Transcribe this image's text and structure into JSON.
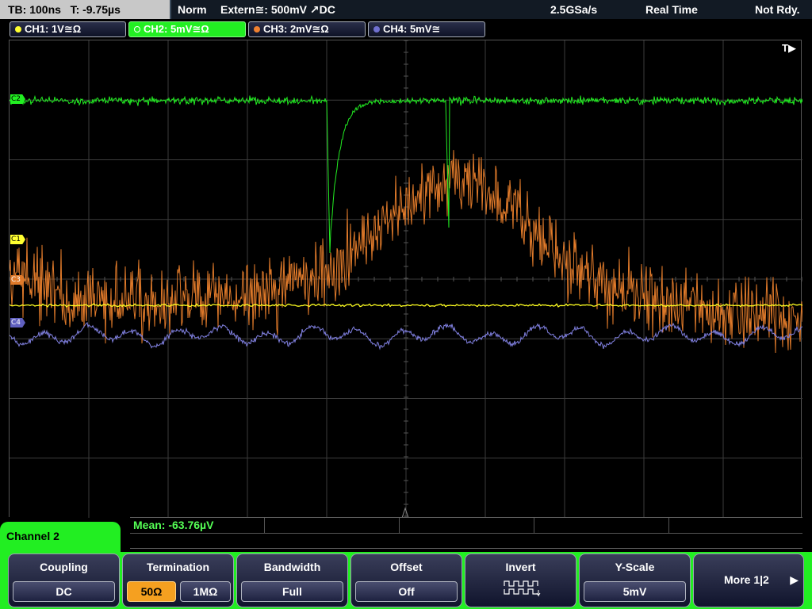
{
  "status": {
    "timebase": "TB: 100ns   T: -9.75µs",
    "trigger_mode": "Norm",
    "trigger_source": "Extern≅: 500mV ↗DC",
    "sample_rate": "2.5GSa/s",
    "acq_mode": "Real Time",
    "state": "Not Rdy."
  },
  "channels": [
    {
      "label": "CH1: 1V≅Ω",
      "color": "#ffff30"
    },
    {
      "label": "CH2: 5mV≅Ω",
      "color": "#22ee22"
    },
    {
      "label": "CH3: 2mV≅Ω",
      "color": "#f08030"
    },
    {
      "label": "CH4: 5mV≅",
      "color": "#7070d0"
    }
  ],
  "screen": {
    "trigger_marker": "T▶",
    "markers": {
      "c1": "C1",
      "c2": "C2",
      "c3": "C3",
      "c4": "C4"
    }
  },
  "measurement": {
    "label": "Mean: -63.76µV"
  },
  "menu": {
    "title": "Channel 2",
    "coupling": {
      "title": "Coupling",
      "value": "DC"
    },
    "termination": {
      "title": "Termination",
      "opt1": "50Ω",
      "opt2": "1MΩ",
      "selected": "50Ω"
    },
    "bandwidth": {
      "title": "Bandwidth",
      "value": "Full"
    },
    "offset": {
      "title": "Offset",
      "value": "Off"
    },
    "invert": {
      "title": "Invert",
      "icon": "invert-waveform-icon"
    },
    "yscale": {
      "title": "Y-Scale",
      "value": "5mV"
    },
    "more": {
      "label": "More 1|2",
      "icon": "arrow-right-icon"
    }
  }
}
